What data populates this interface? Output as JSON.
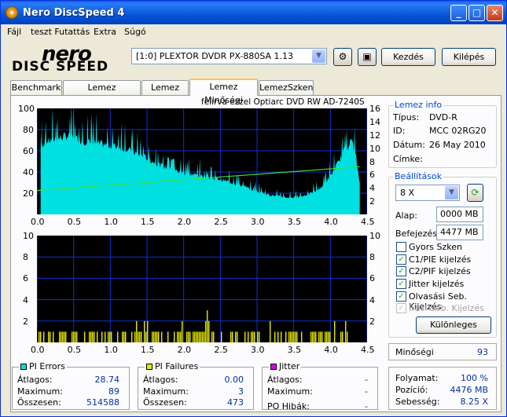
{
  "window": {
    "title": "Nero DiscSpeed 4",
    "minimize": "_",
    "maximize": "□",
    "close": "✕"
  },
  "menu": [
    "Fájl",
    "teszt Futattás",
    "Extra",
    "Súgó"
  ],
  "logo": {
    "line1": "nero",
    "line2": "DISC SPEED"
  },
  "drive": {
    "selected": "[1:0]  PLEXTOR DVDR   PX-880SA 1.13"
  },
  "toolbar": {
    "start_label": "Kezdés",
    "exit_label": "Kilépés"
  },
  "tabs": [
    "Benchmark",
    "Lemez létrehozása",
    "Lemez info",
    "Lemez Minőségi",
    "LemezSzken"
  ],
  "chart_caption": "felírva ezzel Optiarc  DVD RW AD-7240S",
  "chart_data": [
    {
      "type": "area",
      "name": "PI Errors (top)",
      "x_ticks": [
        "0.0",
        "0.5",
        "1.0",
        "1.5",
        "2.0",
        "2.5",
        "3.0",
        "3.5",
        "4.0",
        "4.5"
      ],
      "y_left_ticks": [
        "100",
        "80",
        "60",
        "40",
        "20"
      ],
      "y_right_ticks": [
        "16",
        "14",
        "12",
        "10",
        "8",
        "6",
        "4",
        "2"
      ],
      "ylim_left": [
        0,
        100
      ],
      "ylim_right": [
        0,
        16
      ],
      "xlim": [
        0,
        4.5
      ],
      "x": [
        0.05,
        0.1,
        0.2,
        0.3,
        0.4,
        0.5,
        0.6,
        0.7,
        0.8,
        0.9,
        1.0,
        1.1,
        1.2,
        1.3,
        1.4,
        1.5,
        1.6,
        1.7,
        1.8,
        1.9,
        2.0,
        2.1,
        2.2,
        2.3,
        2.4,
        2.5,
        2.6,
        2.7,
        2.8,
        2.9,
        3.0,
        3.1,
        3.2,
        3.3,
        3.4,
        3.5,
        3.6,
        3.7,
        3.8,
        3.9,
        4.0,
        4.1,
        4.2,
        4.3,
        4.4
      ],
      "values": [
        62,
        68,
        70,
        72,
        74,
        72,
        70,
        68,
        67,
        66,
        65,
        64,
        62,
        59,
        56,
        53,
        49,
        46,
        43,
        41,
        39,
        38,
        37,
        35,
        34,
        33,
        31,
        29,
        27,
        24,
        22,
        20,
        18,
        17,
        16,
        16,
        17,
        19,
        22,
        27,
        36,
        48,
        62,
        70,
        30
      ],
      "speed_line": {
        "x": [
          0,
          4.4
        ],
        "values": [
          3.6,
          7.2
        ]
      }
    },
    {
      "type": "bar",
      "name": "PI Failures (bottom)",
      "x_ticks": [
        "0.0",
        "0.5",
        "1.0",
        "1.5",
        "2.0",
        "2.5",
        "3.0",
        "3.5",
        "4.0",
        "4.5"
      ],
      "y_left_ticks": [
        "10",
        "8",
        "6",
        "4",
        "2"
      ],
      "y_right_ticks": [
        "10",
        "8",
        "6",
        "4",
        "2"
      ],
      "ylim": [
        0,
        10
      ],
      "xlim": [
        0,
        4.5
      ]
    }
  ],
  "stats": {
    "pi_errors": {
      "title": "PI Errors",
      "color": "#00e0e0",
      "avg_label": "Átlagos:",
      "avg": "28.74",
      "max_label": "Maximum:",
      "max": "89",
      "total_label": "Összesen:",
      "total": "514588"
    },
    "pi_failures": {
      "title": "PI Failures",
      "color": "#e8e800",
      "avg_label": "Átlagos:",
      "avg": "0.00",
      "max_label": "Maximum:",
      "max": "3",
      "total_label": "Összesen:",
      "total": "473"
    },
    "jitter": {
      "title": "Jitter",
      "color": "#e000e0",
      "avg_label": "Átlagos:",
      "avg": "-",
      "max_label": "Maximum:",
      "max": "-",
      "po_label": "PO Hibák:",
      "po": "-"
    }
  },
  "disc_info": {
    "title": "Lemez info",
    "type_label": "Típus:",
    "type": "DVD-R",
    "id_label": "ID:",
    "id": "MCC 02RG20",
    "date_label": "Dátum:",
    "date": "26 May 2010",
    "label_label": "Címke:",
    "label": ""
  },
  "settings": {
    "title": "Beállítások",
    "speed": "8 X",
    "start_label": "Alap:",
    "start": "0000 MB",
    "end_label": "Befejezés:",
    "end": "4477 MB",
    "quick_scan": "Gyors Szken",
    "c1": "C1/PIE kijelzés",
    "c2": "C2/PIF kijelzés",
    "jitter": "Jitter kijelzés",
    "read": "Olvasási Seb. Kijelzés",
    "write": "Írási Seb. Kijelzés",
    "advanced": "Különleges"
  },
  "quality": {
    "label": "Minőségi",
    "value": "93"
  },
  "progress": {
    "progress_label": "Folyamat:",
    "progress": "100 %",
    "position_label": "Pozíció:",
    "position": "4476 MB",
    "speed_label": "Sebesség:",
    "speed": "8.25 X"
  }
}
